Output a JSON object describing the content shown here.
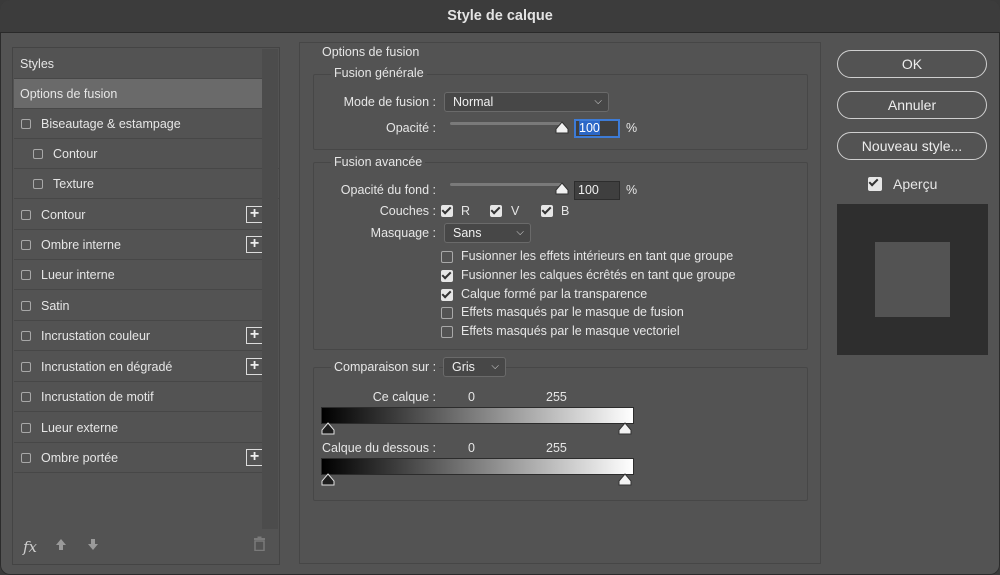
{
  "title": "Style de calque",
  "sidebar": {
    "items": [
      {
        "label": "Styles"
      },
      {
        "label": "Options de fusion"
      },
      {
        "label": "Biseautage & estampage"
      },
      {
        "label": "Contour"
      },
      {
        "label": "Texture"
      },
      {
        "label": "Contour"
      },
      {
        "label": "Ombre interne"
      },
      {
        "label": "Lueur interne"
      },
      {
        "label": "Satin"
      },
      {
        "label": "Incrustation couleur"
      },
      {
        "label": "Incrustation en dégradé"
      },
      {
        "label": "Incrustation de motif"
      },
      {
        "label": "Lueur externe"
      },
      {
        "label": "Ombre portée"
      }
    ],
    "footer": {
      "fx": "fx"
    }
  },
  "blend": {
    "section_title": "Options de fusion",
    "general": {
      "title": "Fusion générale",
      "mode_label": "Mode de fusion :",
      "mode_value": "Normal",
      "opacity_label": "Opacité :",
      "opacity_value": "100",
      "opacity_unit": "%",
      "opacity_fraction": 1.0
    },
    "advanced": {
      "title": "Fusion avancée",
      "fill_label": "Opacité du fond :",
      "fill_value": "100",
      "fill_unit": "%",
      "fill_fraction": 1.0,
      "channels_label": "Couches :",
      "channel_r": "R",
      "channel_v": "V",
      "channel_b": "B",
      "knockout_label": "Masquage :",
      "knockout_value": "Sans",
      "options": [
        {
          "label": "Fusionner les effets intérieurs en tant que groupe",
          "checked": false
        },
        {
          "label": "Fusionner les calques écrêtés en tant que groupe",
          "checked": true
        },
        {
          "label": "Calque formé par la transparence",
          "checked": true
        },
        {
          "label": "Effets masqués par le masque de fusion",
          "checked": false
        },
        {
          "label": "Effets masqués par le masque vectoriel",
          "checked": false
        }
      ]
    },
    "blendif": {
      "label": "Comparaison sur :",
      "value": "Gris",
      "this_layer_label": "Ce calque :",
      "this_layer_min": "0",
      "this_layer_max": "255",
      "underlying_label": "Calque du dessous :",
      "underlying_min": "0",
      "underlying_max": "255"
    }
  },
  "buttons": {
    "ok": "OK",
    "cancel": "Annuler",
    "new_style": "Nouveau style...",
    "preview_label": "Aperçu"
  },
  "icons": {
    "fx": "fx-icon",
    "up": "arrow-up-icon",
    "down": "arrow-down-icon",
    "trash": "trash-icon",
    "plus": "plus-icon"
  }
}
